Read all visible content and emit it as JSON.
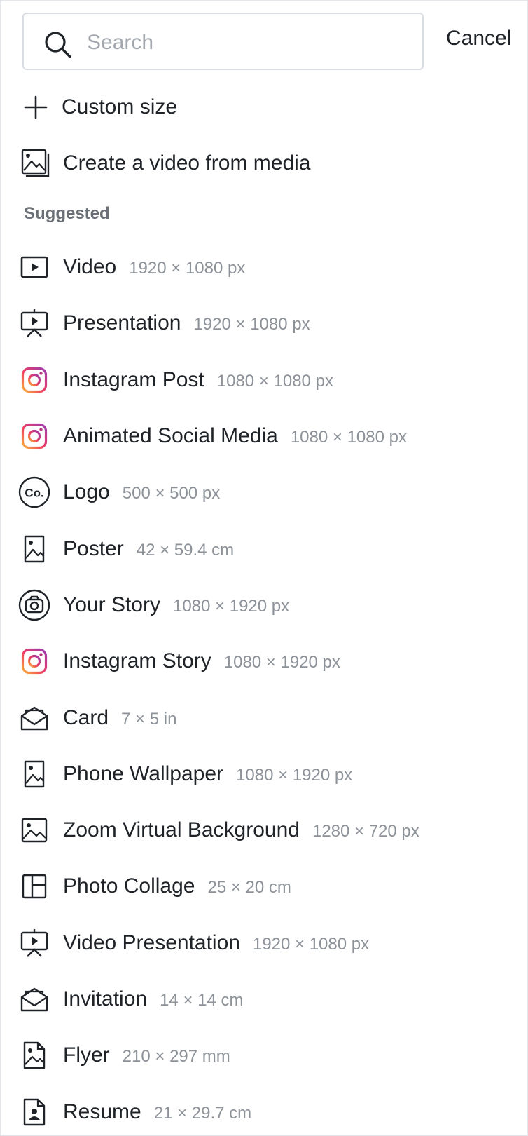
{
  "search": {
    "placeholder": "Search",
    "value": ""
  },
  "cancel_label": "Cancel",
  "actions": {
    "custom_size": {
      "label": "Custom size",
      "icon": "plus-icon"
    },
    "video_from_media": {
      "label": "Create a video from media",
      "icon": "media-stack-icon"
    }
  },
  "suggested_title": "Suggested",
  "colors": {
    "instagram_gradient": [
      "#f58529",
      "#dd2a7b",
      "#8134af"
    ],
    "text_primary": "#1f2328",
    "text_muted": "#8d9299"
  },
  "items": [
    {
      "name": "Video",
      "size": "1920 × 1080 px",
      "icon": "video-icon"
    },
    {
      "name": "Presentation",
      "size": "1920 × 1080 px",
      "icon": "presentation-icon"
    },
    {
      "name": "Instagram Post",
      "size": "1080 × 1080 px",
      "icon": "instagram-icon"
    },
    {
      "name": "Animated Social Media",
      "size": "1080 × 1080 px",
      "icon": "instagram-icon"
    },
    {
      "name": "Logo",
      "size": "500 × 500 px",
      "icon": "logo-co-icon"
    },
    {
      "name": "Poster",
      "size": "42 × 59.4 cm",
      "icon": "poster-icon"
    },
    {
      "name": "Your Story",
      "size": "1080 × 1920 px",
      "icon": "camera-circle-icon"
    },
    {
      "name": "Instagram Story",
      "size": "1080 × 1920 px",
      "icon": "instagram-icon"
    },
    {
      "name": "Card",
      "size": "7 × 5 in",
      "icon": "envelope-icon"
    },
    {
      "name": "Phone Wallpaper",
      "size": "1080 × 1920 px",
      "icon": "poster-icon"
    },
    {
      "name": "Zoom Virtual Background",
      "size": "1280 × 720 px",
      "icon": "image-icon"
    },
    {
      "name": "Photo Collage",
      "size": "25 × 20 cm",
      "icon": "collage-icon"
    },
    {
      "name": "Video Presentation",
      "size": "1920 × 1080 px",
      "icon": "presentation-icon"
    },
    {
      "name": "Invitation",
      "size": "14 × 14 cm",
      "icon": "envelope-icon"
    },
    {
      "name": "Flyer",
      "size": "210 × 297 mm",
      "icon": "flyer-icon"
    },
    {
      "name": "Resume",
      "size": "21 × 29.7 cm",
      "icon": "resume-icon"
    }
  ]
}
